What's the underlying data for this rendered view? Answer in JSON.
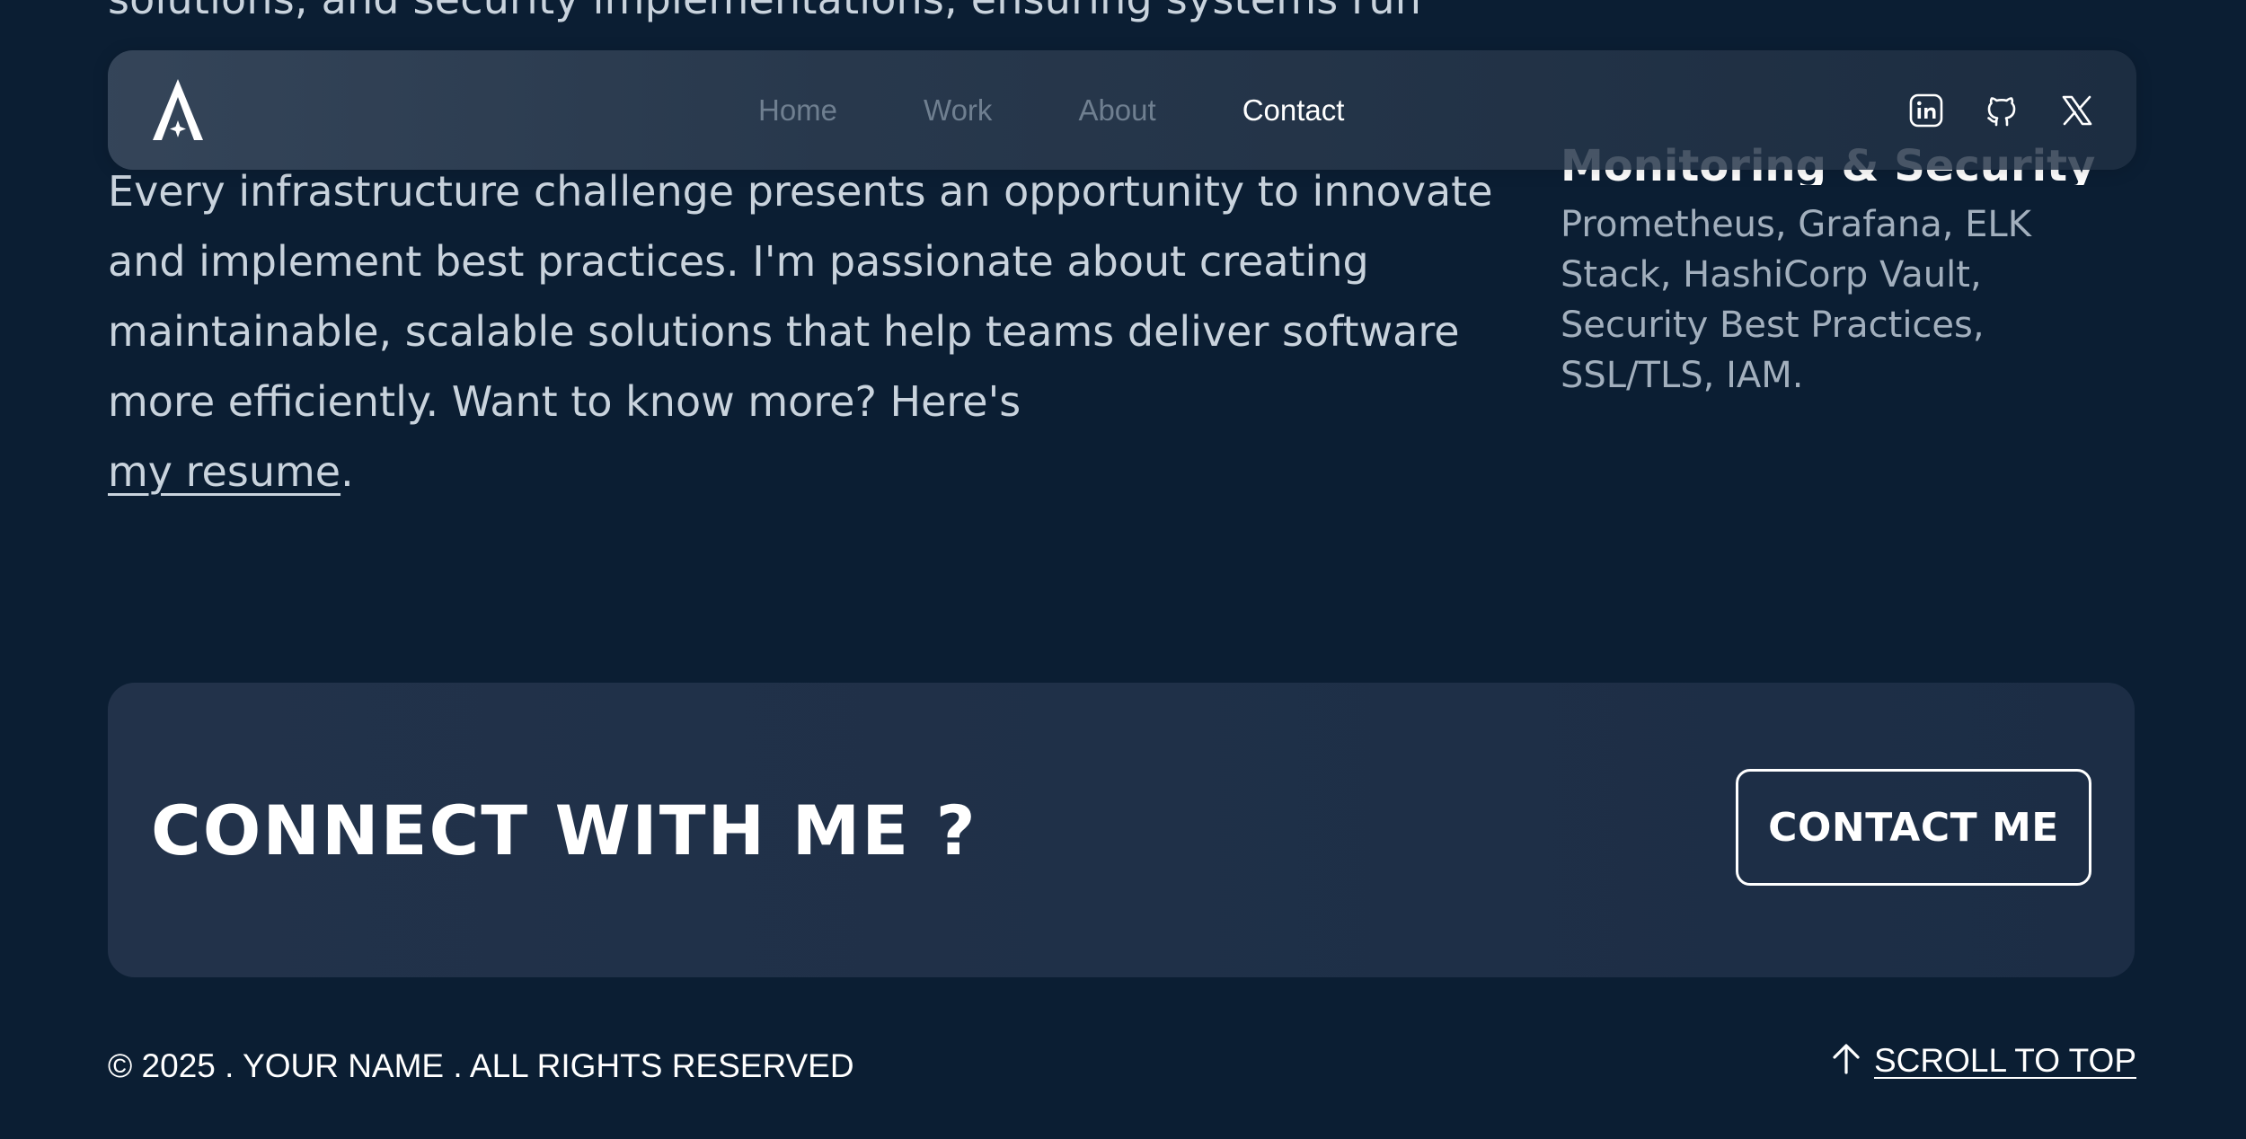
{
  "content": {
    "cut_line": "solutions, and security implementations, ensuring systems run",
    "intro_text": "Every infrastructure challenge presents an opportunity to innovate and implement best practices. I'm passionate about creating maintainable, scalable solutions that help teams deliver software more efficiently. Want to know more? Here's",
    "resume_link": "my resume",
    "period": "."
  },
  "skills": {
    "title": "Monitoring & Security",
    "description": "Prometheus, Grafana, ELK Stack, HashiCorp Vault, Security Best Practices, SSL/TLS, IAM."
  },
  "nav": {
    "logo": "A",
    "links": [
      "Home",
      "Work",
      "About",
      "Contact"
    ],
    "active": "Contact",
    "social": [
      "linkedin-icon",
      "github-icon",
      "x-icon"
    ]
  },
  "connect": {
    "title": "CONNECT WITH ME ?",
    "button": "CONTACT ME"
  },
  "footer": {
    "copyright": "© 2025 . YOUR NAME . ALL RIGHTS RESERVED",
    "scroll_top": "SCROLL TO TOP"
  },
  "colors": {
    "background": "#0b1e33",
    "nav_inactive": "#6f7f90",
    "body_text": "#c9d3dd",
    "muted_text": "#a2afbd"
  }
}
